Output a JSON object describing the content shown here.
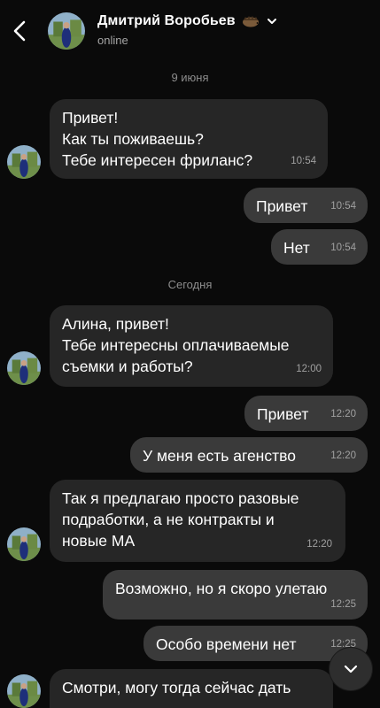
{
  "header": {
    "contact_name": "Дмитрий Воробьев",
    "status": "online",
    "name_emoji_icon": "hedgehog-icon",
    "back_icon": "chevron-left-icon",
    "expand_icon": "chevron-down-icon"
  },
  "dates": [
    "9 июня",
    "Сегодня"
  ],
  "messages": [
    {
      "side": "in",
      "text": "Привет!\nКак ты поживаешь?\nТебе интересен фриланс?",
      "time": "10:54"
    },
    {
      "side": "out",
      "text": "Привет",
      "time": "10:54"
    },
    {
      "side": "out",
      "text": "Нет",
      "time": "10:54"
    },
    {
      "side": "in",
      "text": "Алина, привет!\nТебе интересны оплачиваемые\nсъемки и работы?",
      "time": "12:00"
    },
    {
      "side": "out",
      "text": "Привет",
      "time": "12:20"
    },
    {
      "side": "out",
      "text": "У меня есть агенство",
      "time": "12:20"
    },
    {
      "side": "in",
      "text": "Так я предлагаю просто разовые\nподработки, а не контракты и\nновые МА",
      "time": "12:20"
    },
    {
      "side": "out",
      "text": "Возможно, но я скоро улетаю",
      "time": "12:25"
    },
    {
      "side": "out",
      "text": "Особо времени нет",
      "time": "12:25"
    },
    {
      "side": "in",
      "text": "Смотри, могу тогда сейчас дать",
      "time": ""
    }
  ],
  "scroll_button_icon": "chevron-down-icon",
  "colors": {
    "background": "#0a0a0a",
    "incoming_bubble": "#262626",
    "outgoing_bubble": "#3a3a3a"
  }
}
